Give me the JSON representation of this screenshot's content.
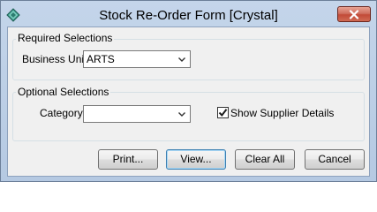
{
  "window": {
    "title": "Stock Re-Order Form  [Crystal]"
  },
  "required_group": {
    "label": "Required Selections",
    "business_unit": {
      "label": "Business Unit",
      "value": "ARTS"
    }
  },
  "optional_group": {
    "label": "Optional Selections",
    "category": {
      "label": "Category",
      "value": ""
    },
    "show_supplier": {
      "label": "Show Supplier Details",
      "checked": true
    }
  },
  "buttons": {
    "print": "Print...",
    "view": "View...",
    "clear_all": "Clear All",
    "cancel": "Cancel"
  },
  "icons": {
    "app": "app-diamond-icon",
    "close": "close-icon",
    "dropdown": "chevron-down-icon",
    "check": "checkmark-icon"
  }
}
